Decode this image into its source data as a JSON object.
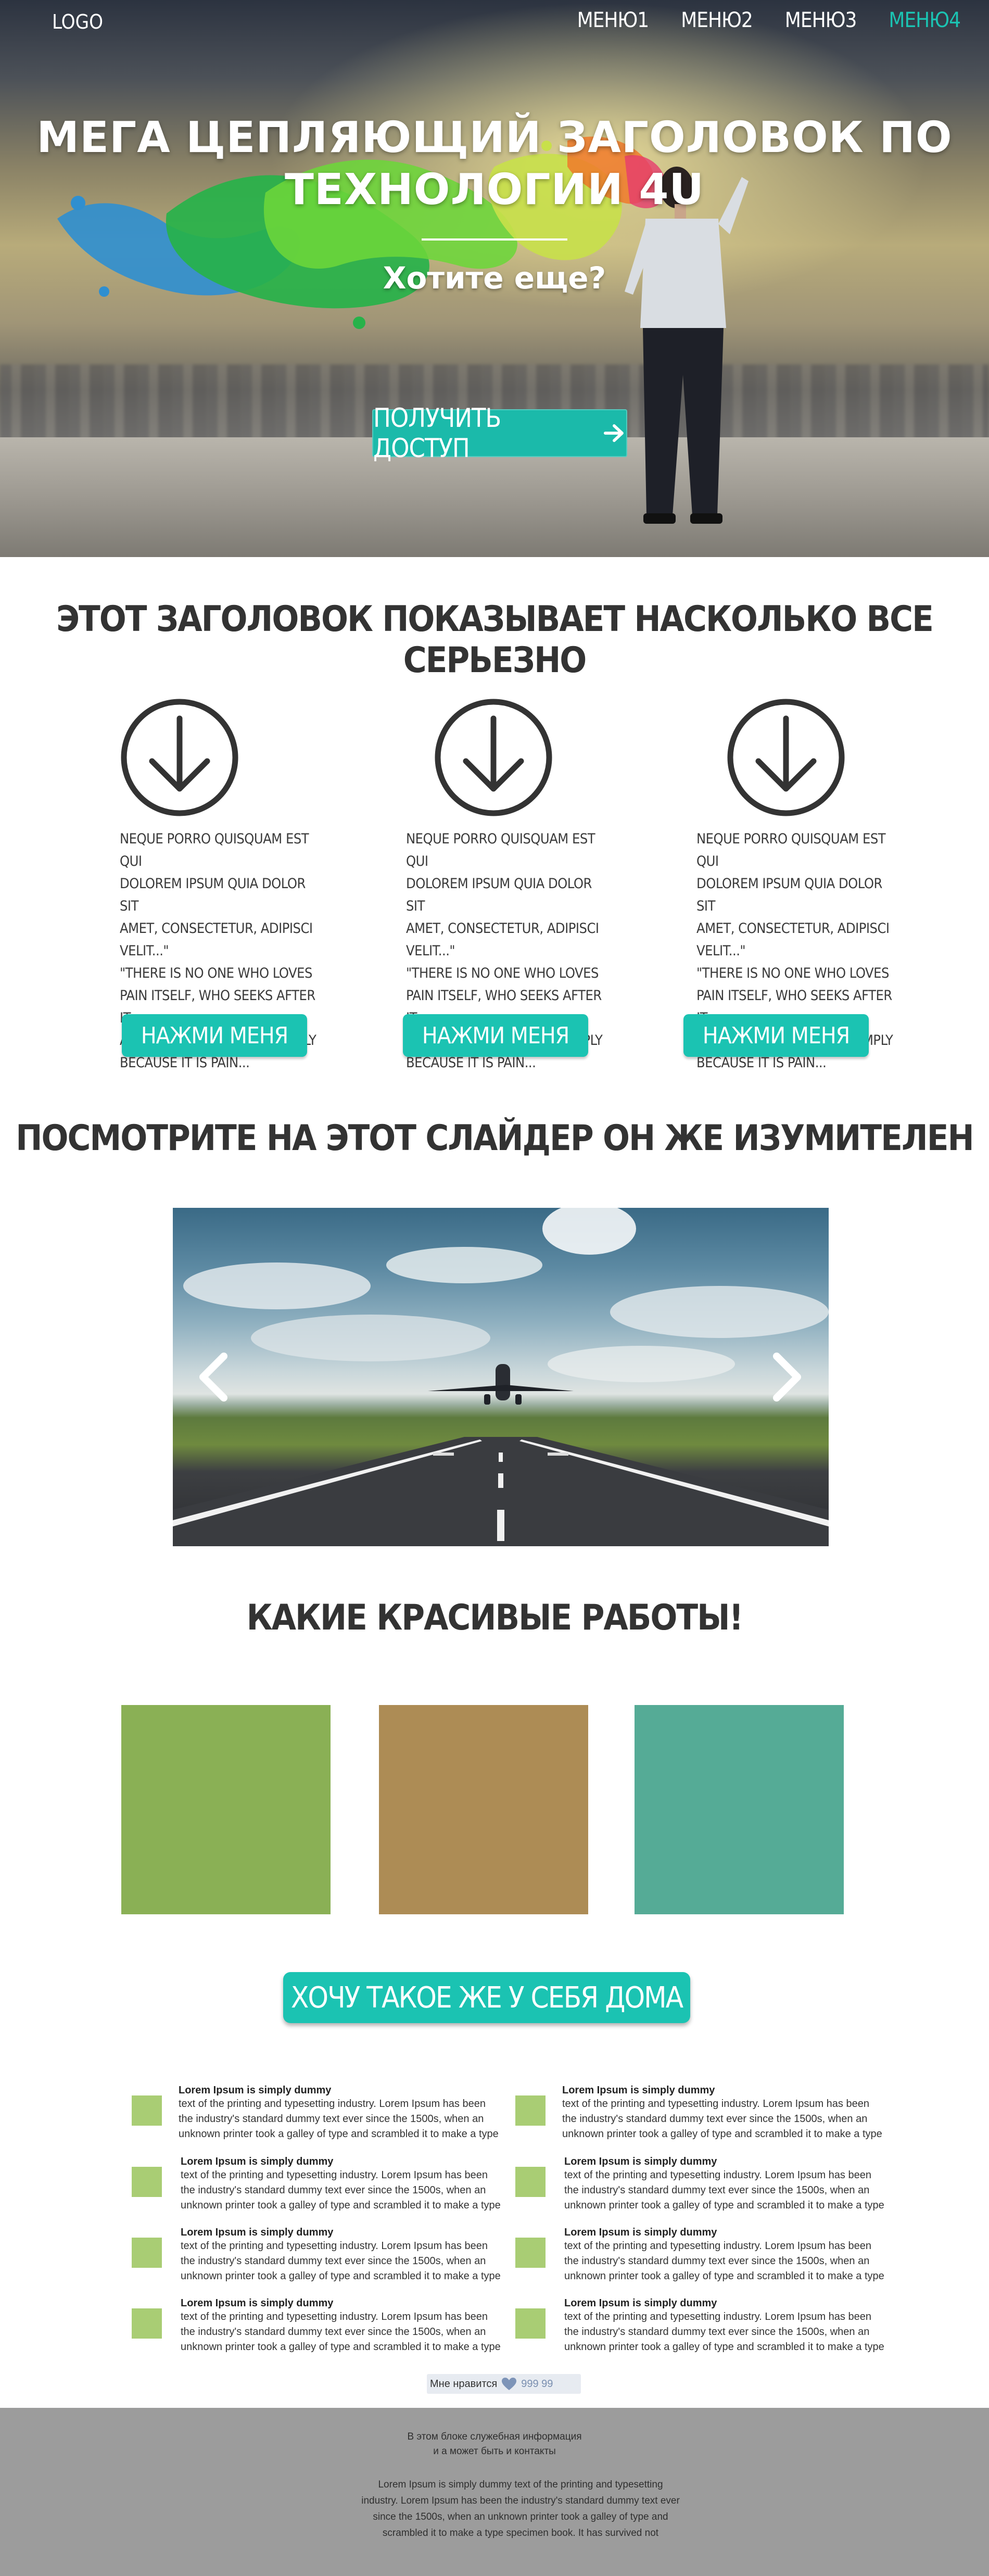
{
  "nav": {
    "logo": "LOGO",
    "menu": [
      {
        "label": "МЕНЮ1",
        "active": false
      },
      {
        "label": "МЕНЮ2",
        "active": false
      },
      {
        "label": "МЕНЮ3",
        "active": false
      },
      {
        "label": "МЕНЮ4",
        "active": true
      }
    ]
  },
  "hero": {
    "title_line1": "МЕГА ЦЕПЛЯЮЩИЙ ЗАГОЛОВОК ПО",
    "title_line2": "ТЕХНОЛОГИИ 4U",
    "subtitle": "Хотите еще?",
    "cta_label": "ПОЛУЧИТЬ ДОСТУП",
    "cta_icon": "arrow-right-icon"
  },
  "features": {
    "title": "ЭТОТ ЗАГОЛОВОК ПОКАЗЫВАЕТ НАСКОЛЬКО ВСЕ СЕРЬЕЗНО",
    "icon": "circle-arrow-down-icon",
    "items": [
      {
        "text": "NEQUE PORRO QUISQUAM EST QUI\nDOLOREM IPSUM QUIA DOLOR SIT\nAMET, CONSECTETUR, ADIPISCI\nVELIT...\"\n\"THERE IS NO ONE WHO LOVES\nPAIN ITSELF, WHO SEEKS AFTER IT\nAND WANTS TO HAVE IT, SIMPLY\nBECAUSE IT IS PAIN...",
        "button": "НАЖМИ МЕНЯ"
      },
      {
        "text": "NEQUE PORRO QUISQUAM EST QUI\nDOLOREM IPSUM QUIA DOLOR SIT\nAMET, CONSECTETUR, ADIPISCI\nVELIT...\"\n\"THERE IS NO ONE WHO LOVES\nPAIN ITSELF, WHO SEEKS AFTER IT\nAND WANTS TO HAVE IT, SIMPLY\nBECAUSE IT IS PAIN...",
        "button": "НАЖМИ МЕНЯ"
      },
      {
        "text": "NEQUE PORRO QUISQUAM EST QUI\nDOLOREM IPSUM QUIA DOLOR SIT\nAMET, CONSECTETUR, ADIPISCI\nVELIT...\"\n\"THERE IS NO ONE WHO LOVES\nPAIN ITSELF, WHO SEEKS AFTER IT\nAND WANTS TO HAVE IT, SIMPLY\nBECAUSE IT IS PAIN...",
        "button": "НАЖМИ МЕНЯ"
      }
    ]
  },
  "slider": {
    "title": "ПОСМОТРИТЕ НА ЭТОТ СЛАЙДЕР ОН ЖЕ ИЗУМИТЕЛЕН",
    "prev_icon": "chevron-left-icon",
    "next_icon": "chevron-right-icon"
  },
  "works": {
    "title": "КАКИЕ КРАСИВЫЕ РАБОТЫ!",
    "tiles": [
      {
        "color": "#8ab055"
      },
      {
        "color": "#ad8c55"
      },
      {
        "color": "#55ab96"
      }
    ],
    "cta": "ХОЧУ ТАКОЕ ЖЕ У СЕБЯ ДОМА"
  },
  "list": {
    "items": [
      {
        "title": "Lorem Ipsum is simply dummy",
        "text": "text of the printing and typesetting industry. Lorem Ipsum has been the industry's standard dummy text ever since the 1500s, when an unknown printer took a galley of type and scrambled it to make a type"
      },
      {
        "title": "Lorem Ipsum is simply dummy",
        "text": "text of the printing and typesetting industry. Lorem Ipsum has been the industry's standard dummy text ever since the 1500s, when an unknown printer took a galley of type and scrambled it to make a type"
      },
      {
        "title": "Lorem Ipsum is simply dummy",
        "text": "text of the printing and typesetting industry. Lorem Ipsum has been the industry's standard dummy text ever since the 1500s, when an unknown printer took a galley of type and scrambled it to make a type"
      },
      {
        "title": "Lorem Ipsum is simply dummy",
        "text": "text of the printing and typesetting industry. Lorem Ipsum has been the industry's standard dummy text ever since the 1500s, when an unknown printer took a galley of type and scrambled it to make a type"
      },
      {
        "title": "Lorem Ipsum is simply dummy",
        "text": "text of the printing and typesetting industry. Lorem Ipsum has been the industry's standard dummy text ever since the 1500s, when an unknown printer took a galley of type and scrambled it to make a type"
      },
      {
        "title": "Lorem Ipsum is simply dummy",
        "text": "text of the printing and typesetting industry. Lorem Ipsum has been the industry's standard dummy text ever since the 1500s, when an unknown printer took a galley of type and scrambled it to make a type"
      },
      {
        "title": "Lorem Ipsum is simply dummy",
        "text": "text of the printing and typesetting industry. Lorem Ipsum has been the industry's standard dummy text ever since the 1500s, when an unknown printer took a galley of type and scrambled it to make a type"
      },
      {
        "title": "Lorem Ipsum is simply dummy",
        "text": "text of the printing and typesetting industry. Lorem Ipsum has been the industry's standard dummy text ever since the 1500s, when an unknown printer took a galley of type and scrambled it to make a type"
      }
    ],
    "square_color": "#a9cd74"
  },
  "like": {
    "label": "Мне нравится",
    "icon": "heart-icon",
    "count": "999 99"
  },
  "footer": {
    "info": "В этом блоке служебная информация\nи а может быть и контакты",
    "about": "Lorem Ipsum is simply dummy text of the printing and typesetting industry. Lorem Ipsum has been the industry's standard dummy text ever since the 1500s, when an unknown printer took a galley of type and scrambled it to make a type specimen book. It has survived not"
  },
  "colors": {
    "accent": "#1bc3b2",
    "footer_bg": "#9c9c9c",
    "heading": "#333333"
  }
}
